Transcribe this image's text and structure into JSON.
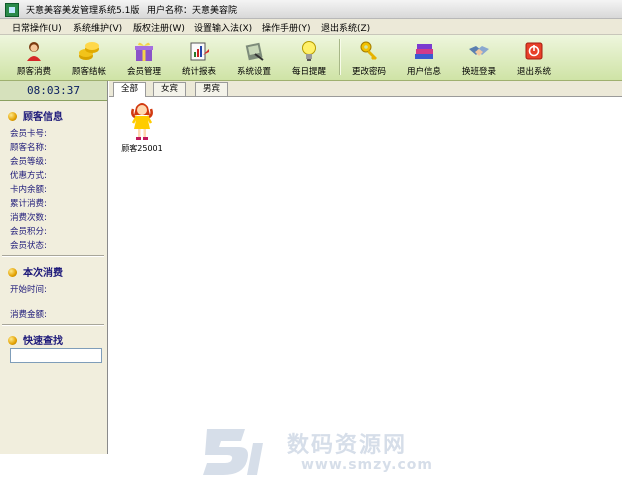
{
  "window": {
    "title": "天意美容美发管理系统5.1版",
    "user_label": "用户名称：天意美容院"
  },
  "menu": [
    {
      "label": "日常操作(U)"
    },
    {
      "label": "系统维护(V)"
    },
    {
      "label": "版权注册(W)"
    },
    {
      "label": "设置输入法(X)"
    },
    {
      "label": "操作手册(Y)"
    },
    {
      "label": "退出系统(Z)"
    }
  ],
  "toolbar": [
    {
      "label": "顾客消费",
      "icon": "customer-consume-icon"
    },
    {
      "label": "顾客结帐",
      "icon": "checkout-coins-icon"
    },
    {
      "label": "会员管理",
      "icon": "member-gift-icon"
    },
    {
      "label": "统计报表",
      "icon": "report-icon"
    },
    {
      "label": "系统设置",
      "icon": "settings-icon"
    },
    {
      "label": "每日提醒",
      "icon": "lightbulb-icon"
    },
    {
      "label": "更改密码",
      "icon": "key-icon"
    },
    {
      "label": "用户信息",
      "icon": "books-icon"
    },
    {
      "label": "换班登录",
      "icon": "handshake-icon"
    },
    {
      "label": "退出系统",
      "icon": "exit-icon"
    }
  ],
  "sidebar": {
    "clock": "08:03:37",
    "customer_info": {
      "title": "顾客信息",
      "fields": [
        "会员卡号:",
        "顾客名称:",
        "会员等级:",
        "优惠方式:",
        "卡内余额:",
        "累计消费:",
        "消费次数:",
        "会员积分:",
        "会员状态:"
      ]
    },
    "current_spending": {
      "title": "本次消费",
      "start_label": "开始时间:",
      "amount_label": "消费金额:"
    },
    "quick_search": {
      "title": "快速查找",
      "value": ""
    }
  },
  "tabs": [
    {
      "label": "全部"
    },
    {
      "label": "女宾"
    },
    {
      "label": "男宾"
    }
  ],
  "customers": [
    {
      "label": "顾客25001"
    }
  ],
  "watermark": {
    "text": "数码资源网",
    "url": "www.smzy.com"
  },
  "colors": {
    "toolbar": "#cfe3a6",
    "sidebar": "#f1eedd",
    "heading_text": "#1e1a7a"
  }
}
